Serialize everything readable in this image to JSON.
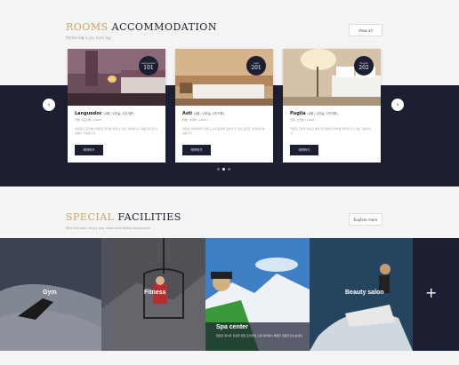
{
  "rooms": {
    "title_accent": "ROOMS",
    "title_rest": "ACCOMMODATION",
    "subtitle": "편안하게 머물 수 있는 최상의 객실",
    "view_all": "View all",
    "cards": [
      {
        "badge_label": "Languedoc",
        "badge_num": "101",
        "name": "Languedoc",
        "name_sub": "(4명 / 2인실, 1인기준)",
        "meta": "전망: 마운틴뷰 | 120m²",
        "desc": "여유로운 공간에서 편안한 휴식을 즐길 수 있는 객실입니다. 넓은 창으로 자연광이 가득합니다.",
        "button": "예약하기"
      },
      {
        "badge_label": "Asti",
        "badge_num": "201",
        "name": "Asti",
        "name_sub": "(4명 / 2인실, 1인기준)",
        "meta": "전망: 시티뷰 | 120m²",
        "desc": "세련된 인테리어와 함께 도시의 풍경을 감상할 수 있는 모던한 스타일의 객실입니다.",
        "button": "예약하기"
      },
      {
        "badge_label": "Puglia",
        "badge_num": "202",
        "name": "Puglia",
        "name_sub": "(4명 / 2인실, 1인기준)",
        "meta": "전망: 오션뷰 | 120m²",
        "desc": "따뜻한 조명과 아늑한 분위기로 편안한 하루를 마무리할 수 있는 객실입니다.",
        "button": "예약하기"
      }
    ]
  },
  "facilities": {
    "title_accent": "SPECIAL",
    "title_rest": "FACILITIES",
    "subtitle": "With the best luxury spa, salon and fitness experience",
    "explore": "Explore more",
    "tiles": [
      {
        "label": "Gym"
      },
      {
        "label": "Fitness"
      },
      {
        "label": "Spa center",
        "desc": "편안한 휴식과 힐링을 위한 프리미엄 스파 센터에서 특별한 경험을 만나보세요."
      },
      {
        "label": "Beauty salon"
      }
    ]
  }
}
